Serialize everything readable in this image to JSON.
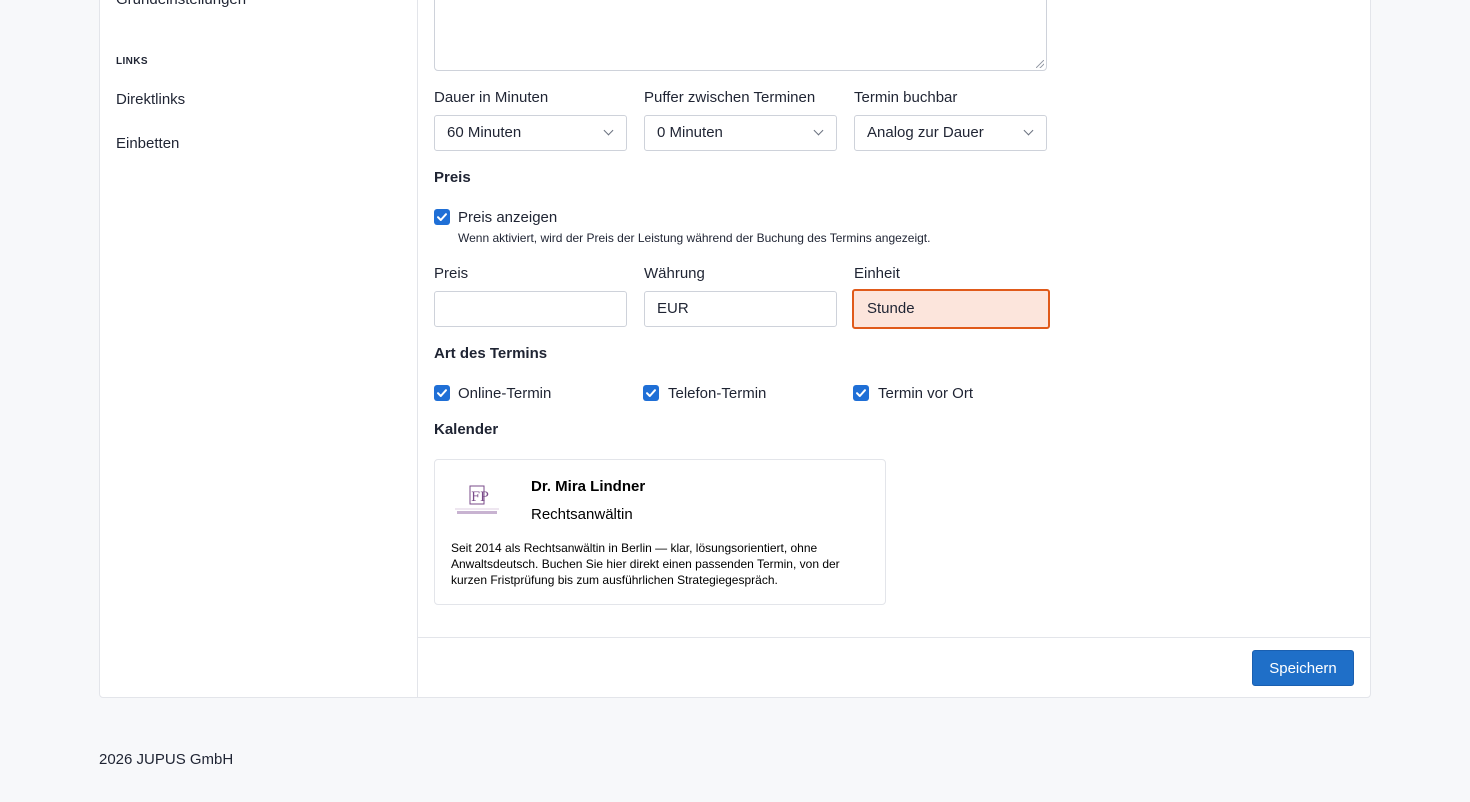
{
  "sidebar": {
    "cut_item": "Grundeinstellungen",
    "section_title": "LINKS",
    "items": [
      {
        "label": "Direktlinks"
      },
      {
        "label": "Einbetten"
      }
    ]
  },
  "form": {
    "duration": {
      "label": "Dauer in Minuten",
      "value": "60 Minuten"
    },
    "buffer": {
      "label": "Puffer zwischen Terminen",
      "value": "0 Minuten"
    },
    "bookable": {
      "label": "Termin buchbar",
      "value": "Analog zur Dauer"
    },
    "price_section": "Preis",
    "show_price": {
      "label": "Preis anzeigen",
      "checked": true,
      "hint": "Wenn aktiviert, wird der Preis der Leistung während der Buchung des Termins angezeigt."
    },
    "price": {
      "label": "Preis",
      "value": ""
    },
    "currency": {
      "label": "Währung",
      "value": "EUR"
    },
    "unit": {
      "label": "Einheit",
      "value": "Stunde"
    },
    "type_section": "Art des Termins",
    "types": [
      {
        "label": "Online-Termin",
        "checked": true
      },
      {
        "label": "Telefon-Termin",
        "checked": true
      },
      {
        "label": "Termin vor Ort",
        "checked": true
      }
    ],
    "calendar_section": "Kalender"
  },
  "profile": {
    "name": "Dr. Mira Lindner",
    "role": "Rechtsanwältin",
    "bio": "Seit 2014 als Rechtsanwältin in Berlin — klar, lösungsorientiert, ohne Anwaltsdeutsch. Buchen Sie hier direkt einen passenden Termin, von der kurzen Fristprüfung bis zum ausführlichen Strategiegespräch.",
    "logo_icon": "law-firm-logo"
  },
  "actions": {
    "save_label": "Speichern"
  },
  "footer": {
    "copyright": "2026 JUPUS GmbH"
  },
  "colors": {
    "accent": "#1f6fc8",
    "highlight_border": "#e05a1a",
    "highlight_bg": "#fce5dc"
  }
}
